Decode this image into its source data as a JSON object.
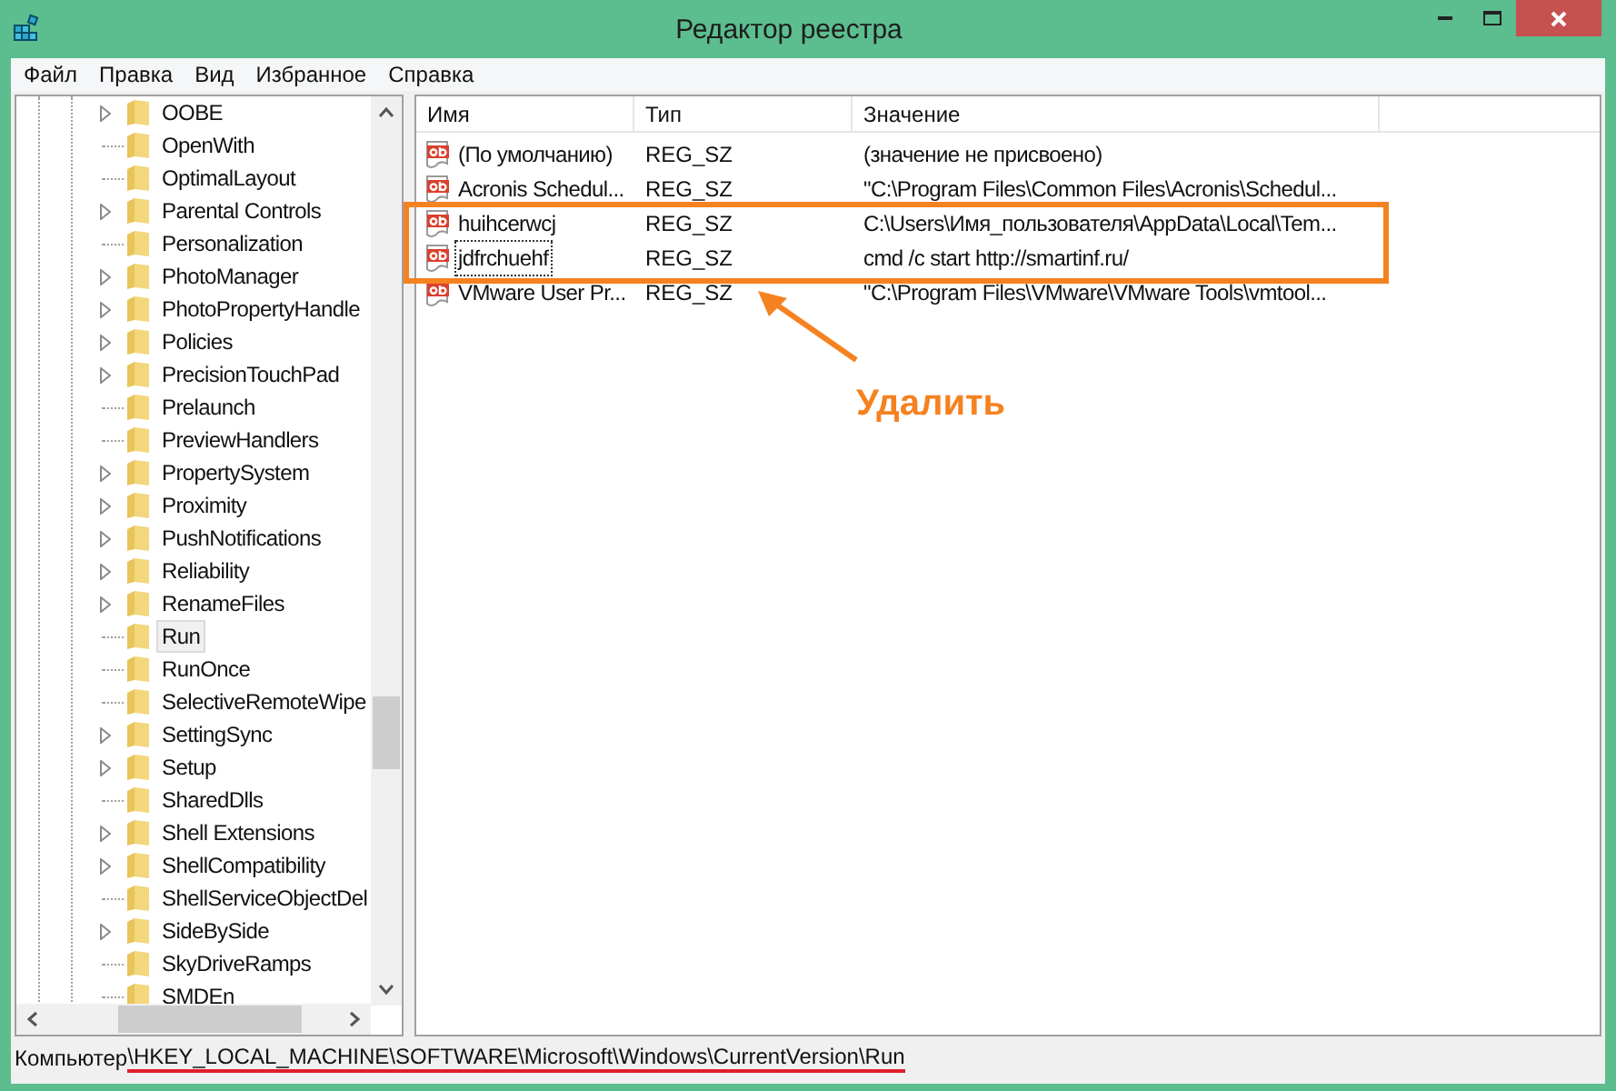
{
  "window": {
    "title": "Редактор реестра"
  },
  "menu": [
    "Файл",
    "Правка",
    "Вид",
    "Избранное",
    "Справка"
  ],
  "tree": {
    "items": [
      {
        "label": "OOBE",
        "has_children": true,
        "selected": false
      },
      {
        "label": "OpenWith",
        "has_children": false,
        "selected": false
      },
      {
        "label": "OptimalLayout",
        "has_children": false,
        "selected": false
      },
      {
        "label": "Parental Controls",
        "has_children": true,
        "selected": false
      },
      {
        "label": "Personalization",
        "has_children": false,
        "selected": false
      },
      {
        "label": "PhotoManager",
        "has_children": true,
        "selected": false
      },
      {
        "label": "PhotoPropertyHandle",
        "has_children": true,
        "selected": false
      },
      {
        "label": "Policies",
        "has_children": true,
        "selected": false
      },
      {
        "label": "PrecisionTouchPad",
        "has_children": true,
        "selected": false
      },
      {
        "label": "Prelaunch",
        "has_children": false,
        "selected": false
      },
      {
        "label": "PreviewHandlers",
        "has_children": false,
        "selected": false
      },
      {
        "label": "PropertySystem",
        "has_children": true,
        "selected": false
      },
      {
        "label": "Proximity",
        "has_children": true,
        "selected": false
      },
      {
        "label": "PushNotifications",
        "has_children": true,
        "selected": false
      },
      {
        "label": "Reliability",
        "has_children": true,
        "selected": false
      },
      {
        "label": "RenameFiles",
        "has_children": true,
        "selected": false
      },
      {
        "label": "Run",
        "has_children": false,
        "selected": true
      },
      {
        "label": "RunOnce",
        "has_children": false,
        "selected": false
      },
      {
        "label": "SelectiveRemoteWipe",
        "has_children": false,
        "selected": false
      },
      {
        "label": "SettingSync",
        "has_children": true,
        "selected": false
      },
      {
        "label": "Setup",
        "has_children": true,
        "selected": false
      },
      {
        "label": "SharedDlls",
        "has_children": false,
        "selected": false
      },
      {
        "label": "Shell Extensions",
        "has_children": true,
        "selected": false
      },
      {
        "label": "ShellCompatibility",
        "has_children": true,
        "selected": false
      },
      {
        "label": "ShellServiceObjectDel",
        "has_children": false,
        "selected": false
      },
      {
        "label": "SideBySide",
        "has_children": true,
        "selected": false
      },
      {
        "label": "SkyDriveRamps",
        "has_children": false,
        "selected": false
      },
      {
        "label": "SMDEn",
        "has_children": false,
        "selected": false
      }
    ]
  },
  "values": {
    "columns": [
      "Имя",
      "Тип",
      "Значение"
    ],
    "rows": [
      {
        "name": "(По умолчанию)",
        "type": "REG_SZ",
        "data": "(значение не присвоено)",
        "focused": false
      },
      {
        "name": "Acronis Schedul...",
        "type": "REG_SZ",
        "data": "\"C:\\Program Files\\Common Files\\Acronis\\Schedul...",
        "focused": false
      },
      {
        "name": "huihcerwcj",
        "type": "REG_SZ",
        "data": "C:\\Users\\Имя_пользователя\\AppData\\Local\\Tem...",
        "focused": false
      },
      {
        "name": "jdfrchuehf",
        "type": "REG_SZ",
        "data": "cmd /c start http://smartinf.ru/",
        "focused": true
      },
      {
        "name": "VMware User Pr...",
        "type": "REG_SZ",
        "data": "\"C:\\Program Files\\VMware\\VMware Tools\\vmtool...",
        "focused": false
      }
    ]
  },
  "annotation": {
    "label": "Удалить"
  },
  "status_bar": {
    "root": "Компьютер",
    "path": "\\HKEY_LOCAL_MACHINE\\SOFTWARE\\Microsoft\\Windows\\CurrentVersion\\Run"
  }
}
